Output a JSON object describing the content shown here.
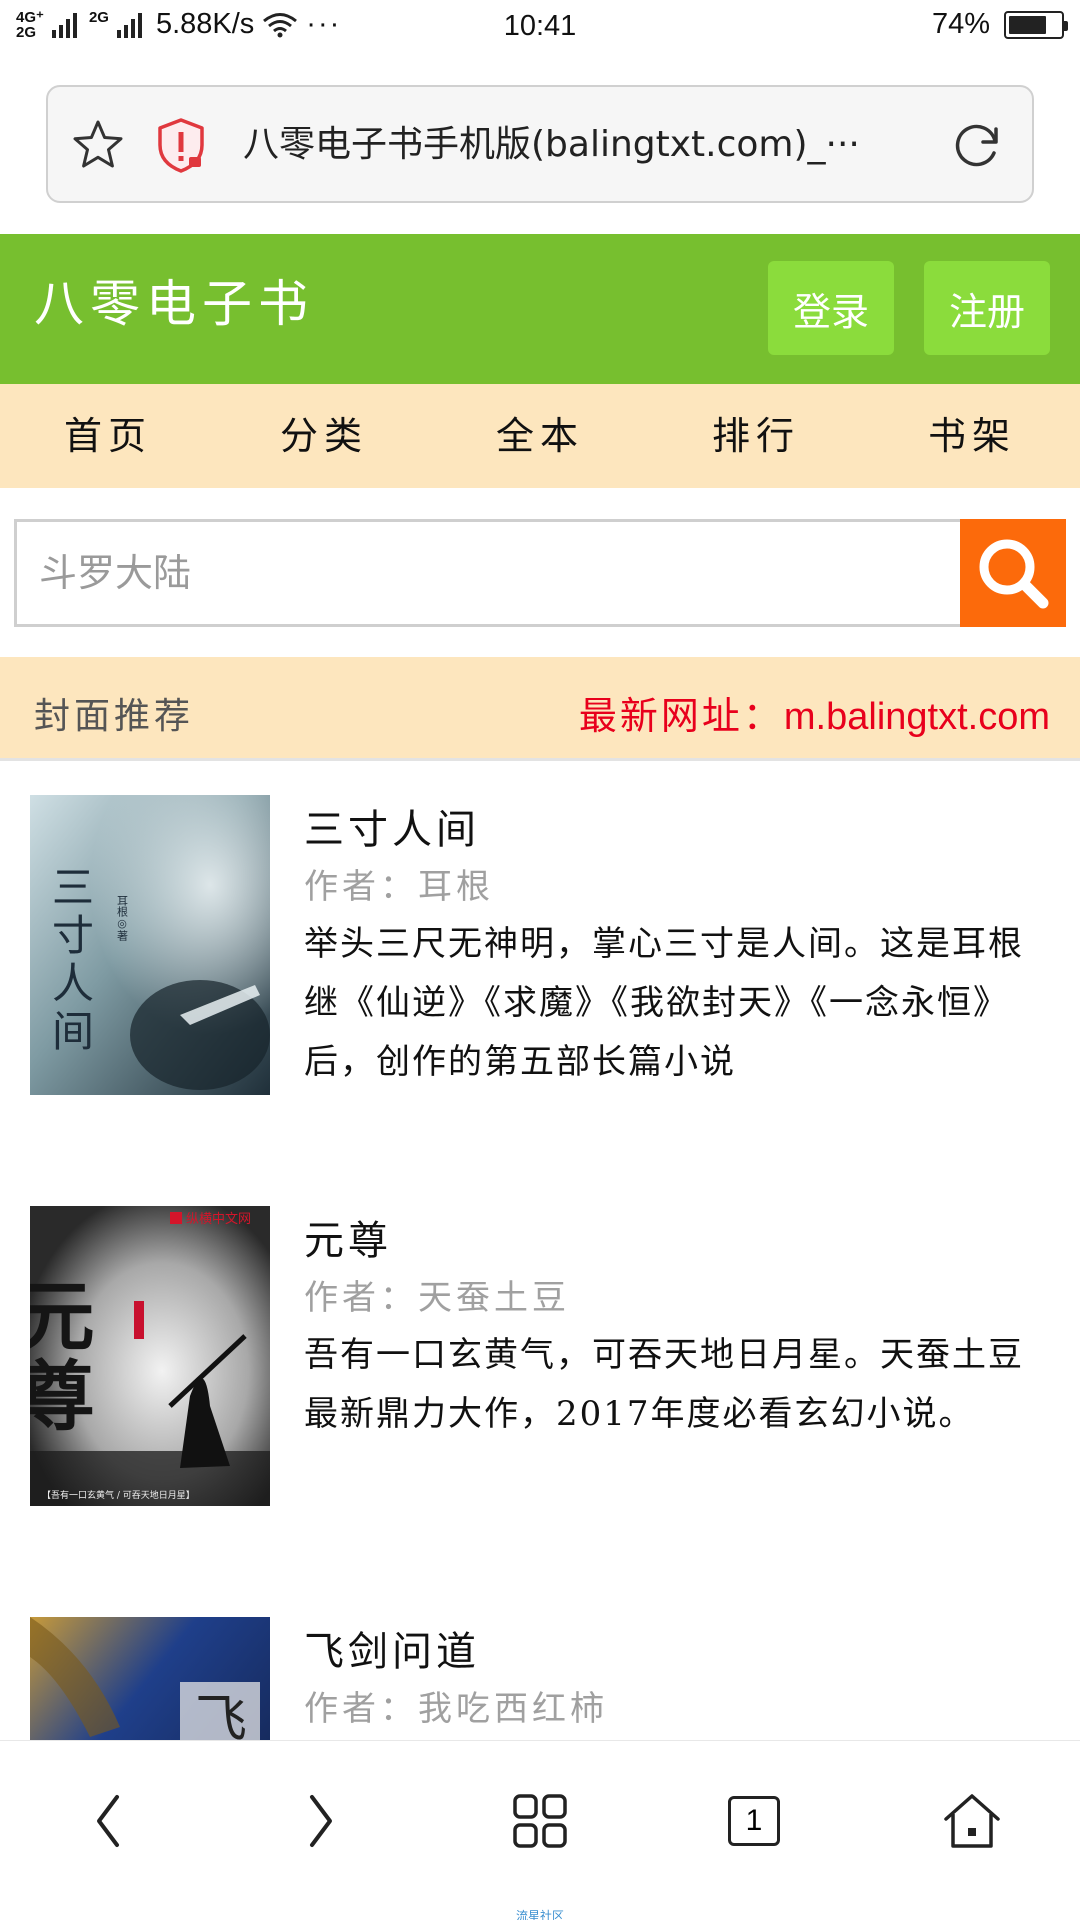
{
  "status_bar": {
    "network_top": "4G⁺",
    "network_bottom": "2G",
    "network_2g": "2G",
    "speed": "5.88K/s",
    "more": "···",
    "time": "10:41",
    "battery": "74%",
    "battery_level": 0.74
  },
  "browser": {
    "url_text": "八零电子书手机版(balingtxt.com)_···"
  },
  "header": {
    "logo": "八零电子书",
    "login_label": "登录",
    "register_label": "注册"
  },
  "nav": {
    "items": [
      {
        "label": "首页"
      },
      {
        "label": "分类"
      },
      {
        "label": "全本"
      },
      {
        "label": "排行"
      },
      {
        "label": "书架"
      }
    ]
  },
  "search": {
    "placeholder": "斗罗大陆"
  },
  "recommend": {
    "title": "封面推荐",
    "latest_label": "最新网址：",
    "latest_url": "m.balingtxt.com"
  },
  "books": [
    {
      "title": "三寸人间",
      "author": "作者：耳根",
      "description": "举头三尺无神明，掌心三寸是人间。这是耳根继《仙逆》《求魔》《我欲封天》《一念永恒》后，创作的第五部长篇小说",
      "cover_text": "三寸人间",
      "cover_small": "耳根◎著"
    },
    {
      "title": "元尊",
      "author": "作者：天蚕土豆",
      "description": "吾有一口玄黄气，可吞天地日月星。天蚕土豆最新鼎力大作，2017年度必看玄幻小说。",
      "cover_text": "元尊",
      "cover_publisher": "纵横中文网",
      "cover_tagline": "【吾有一口玄黄气 / 可吞天地日月星】"
    },
    {
      "title": "飞剑问道",
      "author": "作者：我吃西红柿",
      "description": "",
      "cover_text": "飞"
    }
  ],
  "bottom_bar": {
    "tab_count": "1",
    "label": "流星社区"
  }
}
